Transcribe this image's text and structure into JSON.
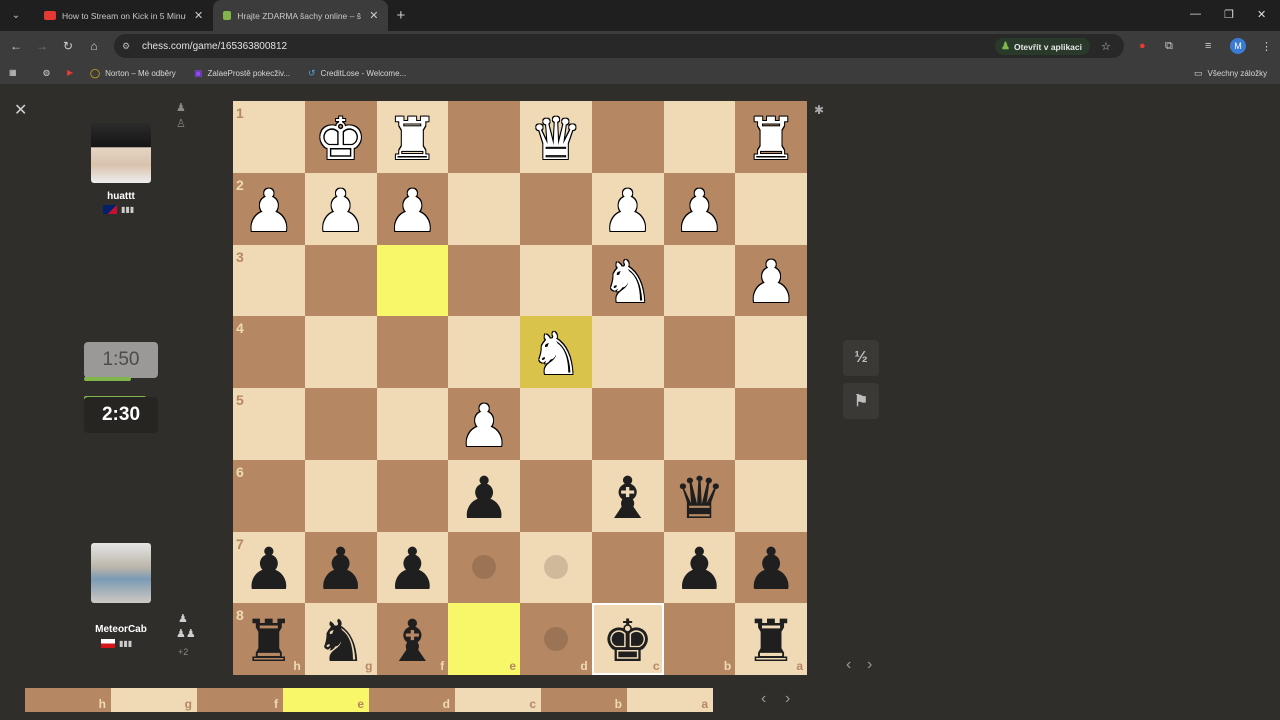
{
  "browser": {
    "tabs": [
      {
        "title": "How to Stream on Kick in 5 Minut",
        "favicon_color": "#e53935",
        "active": false
      },
      {
        "title": "Hrajte ZDARMA šachy online – šac",
        "favicon_color": "#81b64c",
        "active": true
      }
    ],
    "url": "chess.com/game/165363800812",
    "open_app_label": "Otevřít v aplikaci",
    "profile_initial": "M",
    "bookmarks": [
      {
        "label": "Norton – Mé odběry",
        "icon": "norton-icon"
      },
      {
        "label": "ZalaeProstě pokecživ...",
        "icon": "twitch-icon"
      },
      {
        "label": "CreditLose - Welcome...",
        "icon": "creditlose-icon"
      }
    ],
    "all_bookmarks_label": "Všechny záložky"
  },
  "players": {
    "top": {
      "name": "huattt",
      "clock": "1:50",
      "country": "Australia"
    },
    "bottom": {
      "name": "MeteorCab",
      "clock": "2:30",
      "country": "Czech Republic",
      "material": "+2"
    }
  },
  "board": {
    "ranks": [
      "1",
      "2",
      "3",
      "4",
      "5",
      "6",
      "7",
      "8"
    ],
    "files": [
      "h",
      "g",
      "f",
      "e",
      "d",
      "c",
      "b",
      "a"
    ],
    "rows": [
      [
        "",
        "wK",
        "wR",
        "",
        "wQ",
        "",
        "",
        "wR"
      ],
      [
        "wP",
        "wP",
        "wP",
        "",
        "",
        "wP",
        "wP",
        ""
      ],
      [
        "",
        "",
        "",
        "",
        "",
        "wN",
        "",
        "wP"
      ],
      [
        "",
        "",
        "",
        "",
        "wN",
        "",
        "",
        ""
      ],
      [
        "",
        "",
        "",
        "wP",
        "",
        "",
        "",
        ""
      ],
      [
        "",
        "",
        "",
        "bP",
        "",
        "bB",
        "bQ",
        ""
      ],
      [
        "bP",
        "bP",
        "bP",
        "",
        "",
        "",
        "bP",
        "bP"
      ],
      [
        "bR",
        "bN",
        "bB",
        "",
        "",
        "bK",
        "",
        "bR"
      ]
    ],
    "highlight": [
      [
        2,
        2
      ],
      [
        3,
        4
      ],
      [
        7,
        3
      ]
    ],
    "dots": [
      [
        6,
        3
      ],
      [
        6,
        4
      ],
      [
        7,
        4
      ]
    ],
    "selected": [
      7,
      5
    ]
  },
  "controls": {
    "draw_label": "½",
    "resign_icon": "flag-icon"
  },
  "strip": {
    "labels": [
      "h",
      "g",
      "f",
      "e",
      "d",
      "c",
      "b",
      "a"
    ]
  }
}
